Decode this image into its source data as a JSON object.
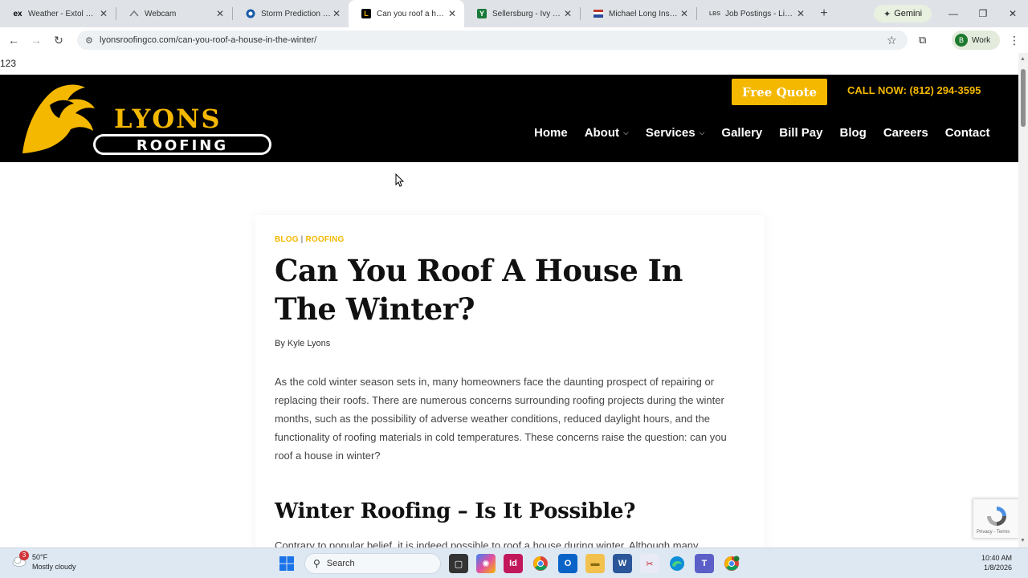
{
  "browser": {
    "tabs": [
      {
        "title": "Weather - Extol Media",
        "icon": "ex",
        "icon_color": "#000000"
      },
      {
        "title": "Webcam",
        "icon": "webcam",
        "icon_color": "#888888"
      },
      {
        "title": "Storm Prediction Center",
        "icon": "noaa",
        "icon_color": "#1a5aa8"
      },
      {
        "title": "Can you roof a house in the winter",
        "icon": "lyons",
        "icon_color": "#000000",
        "active": true
      },
      {
        "title": "Sellersburg - Ivy Tech",
        "icon": "ivy",
        "icon_color": "#1a7a3a"
      },
      {
        "title": "Michael Long Insurance",
        "icon": "flag",
        "icon_color": "#c0392b"
      },
      {
        "title": "Job Postings - Libs Paradise",
        "icon": "libs",
        "icon_color": "#555555"
      }
    ],
    "gemini_label": "Gemini",
    "url": "lyonsroofingco.com/can-you-roof-a-house-in-the-winter/",
    "profile_initial": "B",
    "profile_label": "Work"
  },
  "page": {
    "stray_text": "123",
    "header": {
      "logo_top": "LYONS",
      "logo_bottom": "ROOFING",
      "cta_label": "Free Quote",
      "call_label": "CALL NOW: (812) 294-3595",
      "menu": [
        {
          "label": "Home",
          "dropdown": false
        },
        {
          "label": "About",
          "dropdown": true
        },
        {
          "label": "Services",
          "dropdown": true
        },
        {
          "label": "Gallery",
          "dropdown": false
        },
        {
          "label": "Bill Pay",
          "dropdown": false
        },
        {
          "label": "Blog",
          "dropdown": false
        },
        {
          "label": "Careers",
          "dropdown": false
        },
        {
          "label": "Contact",
          "dropdown": false
        }
      ]
    },
    "article": {
      "category_1": "BLOG",
      "category_sep": "|",
      "category_2": "ROOFING",
      "title": "Can You Roof A House In The Winter?",
      "byline": "By Kyle Lyons",
      "intro": "As the cold winter season sets in, many homeowners face the daunting prospect of repairing or replacing their roofs. There are numerous concerns surrounding roofing projects during the winter months, such as the possibility of adverse weather conditions, reduced daylight hours, and the functionality of roofing materials in cold temperatures. These concerns raise the question: can you roof a house in winter?",
      "h2": "Winter Roofing – Is It Possible?",
      "cut_text": "Contrary to popular belief, it is indeed possible to roof a house during winter. Although many"
    },
    "recaptcha_terms": "Privacy - Terms"
  },
  "taskbar": {
    "weather_temp": "50°F",
    "weather_desc": "Mostly cloudy",
    "weather_badge": "3",
    "search_label": "Search",
    "time": "10:40 AM",
    "date": "1/8/2026"
  },
  "colors": {
    "brand_gold": "#f5b800",
    "header_bg": "#000000"
  }
}
